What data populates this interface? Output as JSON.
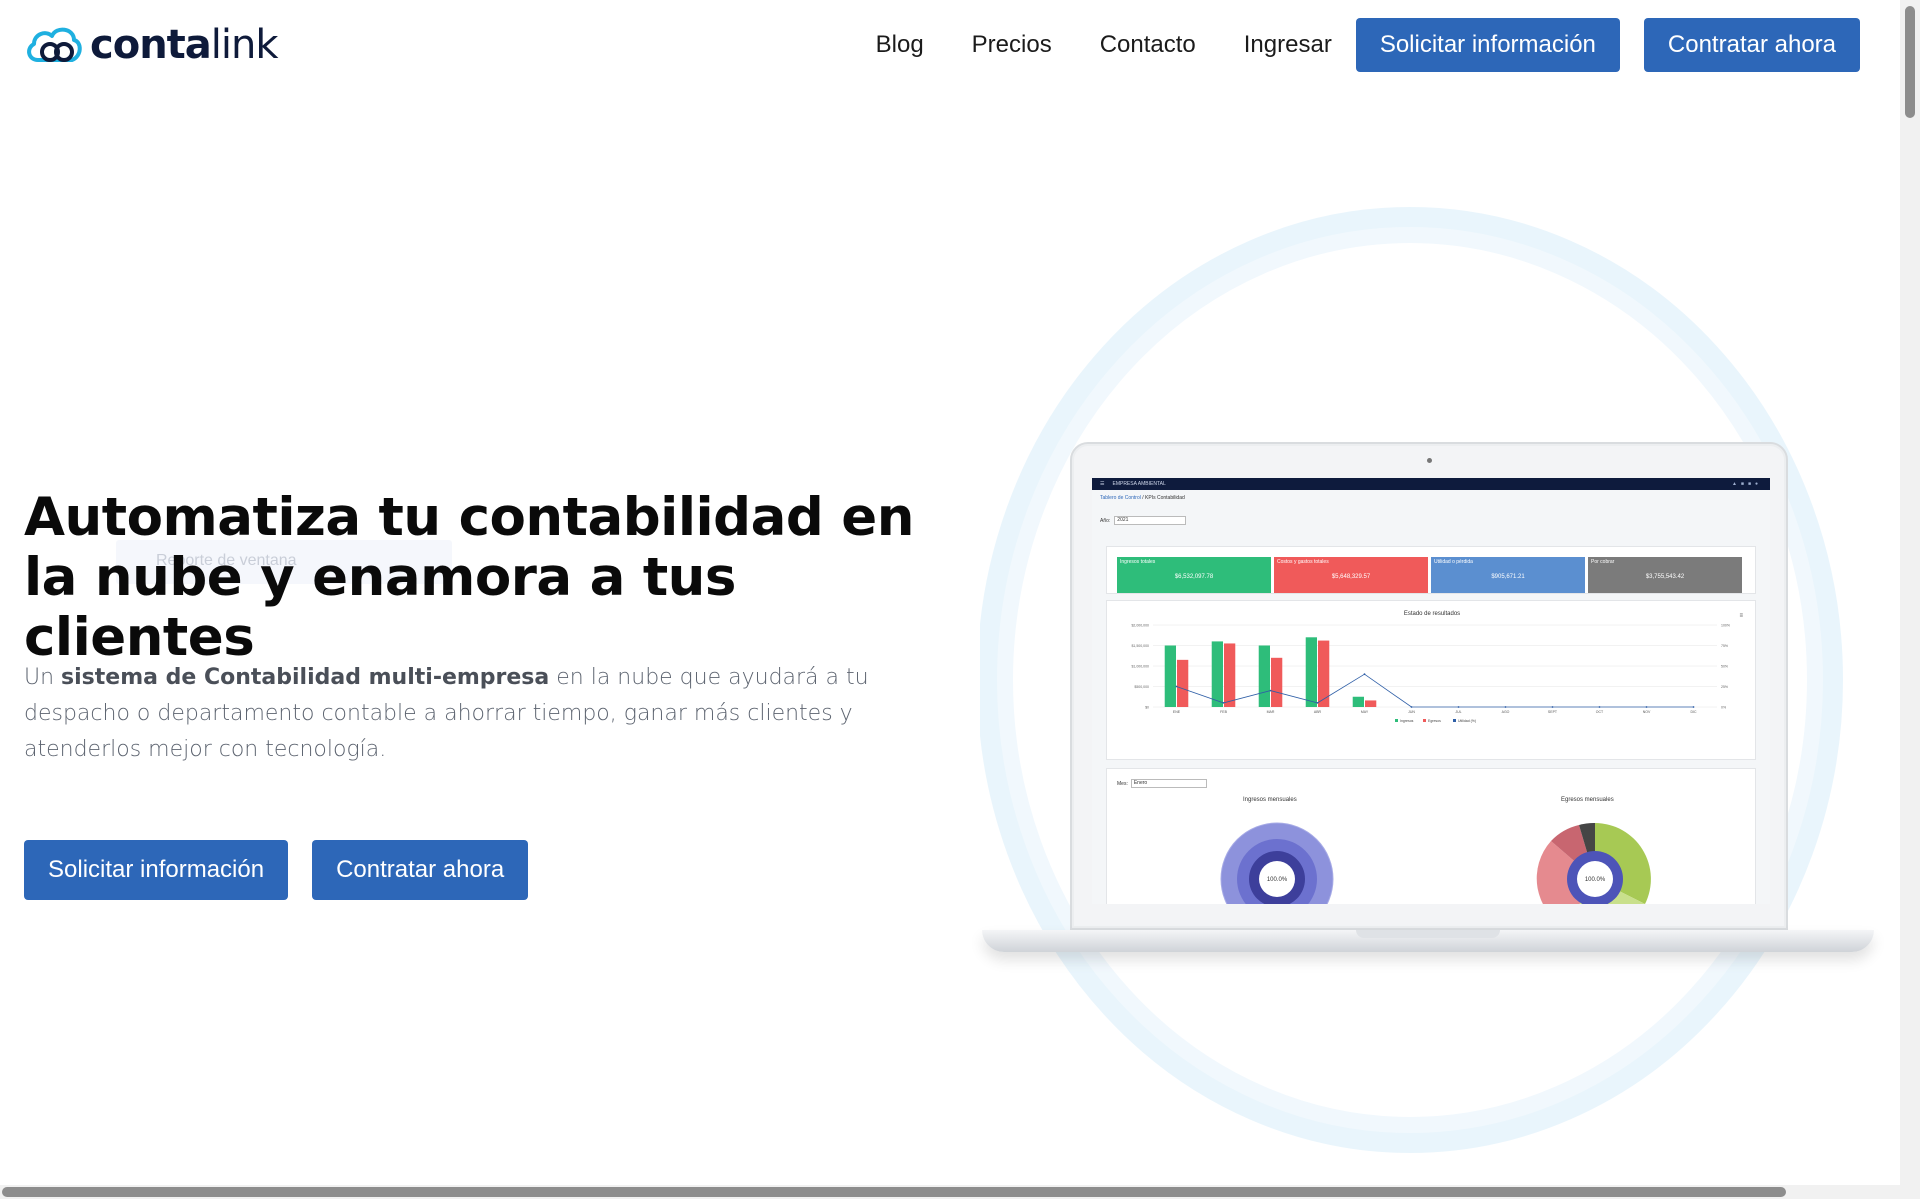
{
  "brand": {
    "name_light": "conta",
    "name_bold": "link",
    "logo_icon": "cloud-icon",
    "color": "#0e1a3a",
    "accent": "#1fb0e0"
  },
  "nav": {
    "links": [
      "Blog",
      "Precios",
      "Contacto",
      "Ingresar"
    ],
    "cta_primary": "Solicitar información",
    "cta_secondary": "Contratar ahora"
  },
  "hero": {
    "title": "Automatiza tu contabilidad en la nube y enamora a tus clientes",
    "tooltip_text": "Reporte de ventana",
    "description_prefix": "Un ",
    "description_bold": "sistema de Contabilidad multi-empresa",
    "description_rest": " en la nube que ayudará a tu despacho o departamento contable a ahorrar tiempo, ganar más clientes y atenderlos mejor con tecnología.",
    "cta_primary": "Solicitar información",
    "cta_secondary": "Contratar ahora"
  },
  "colors": {
    "button": "#2d67b8",
    "ingresos": "#2ebd7a",
    "egresos": "#f05a5a",
    "utilidad": "#2f5fa7"
  },
  "dashboard": {
    "app_name": "EMPRESA AMBIENTAL",
    "breadcrumb_link": "Tablero de Control",
    "breadcrumb_rest": " / KPIs Contabilidad",
    "year_label": "Año:",
    "year_value": "2021",
    "kpis": [
      {
        "label": "Ingresos totales",
        "amount": "$6,532,097.78",
        "color": "#2ebd7a"
      },
      {
        "label": "Costos y gastos totales",
        "amount": "$5,648,329.57",
        "color": "#f05a5a"
      },
      {
        "label": "Utilidad o pérdida",
        "amount": "$905,671.21",
        "color": "#5b8fd0"
      },
      {
        "label": "Por cobrar",
        "amount": "$3,755,543.42",
        "color": "#7b7b7b"
      }
    ],
    "month_label": "Mes:",
    "month_value": "Enero",
    "pie_left_title": "Ingresos mensuales",
    "pie_right_title": "Egresos mensuales",
    "pie_center": "100.0%"
  },
  "chart_data": {
    "type": "bar",
    "title": "Estado de resultados",
    "categories": [
      "ENE",
      "FEB",
      "MAR",
      "ABR",
      "MAY",
      "JUN",
      "JUL",
      "AGO",
      "SEPT",
      "OCT",
      "NOV",
      "DIC"
    ],
    "series": [
      {
        "name": "Ingresos",
        "type": "bar",
        "values": [
          1500000,
          1600000,
          1500000,
          1700000,
          250000,
          0,
          0,
          0,
          0,
          0,
          0,
          0
        ]
      },
      {
        "name": "Egresos",
        "type": "bar",
        "values": [
          1150000,
          1550000,
          1200000,
          1620000,
          160000,
          0,
          0,
          0,
          0,
          0,
          0,
          0
        ]
      },
      {
        "name": "Utilidad (%)",
        "type": "line",
        "values": [
          25,
          5,
          20,
          5,
          40,
          0,
          0,
          0,
          0,
          0,
          0,
          0
        ]
      }
    ],
    "ylim": [
      0,
      2000000
    ],
    "y2lim": [
      0,
      100
    ],
    "yticks": [
      "$0",
      "$500,000",
      "$1,000,000",
      "$1,500,000",
      "$2,000,000"
    ],
    "y2ticks": [
      "0%",
      "25%",
      "50%",
      "75%",
      "100%"
    ],
    "legend": "bottom-center",
    "grid": true
  }
}
